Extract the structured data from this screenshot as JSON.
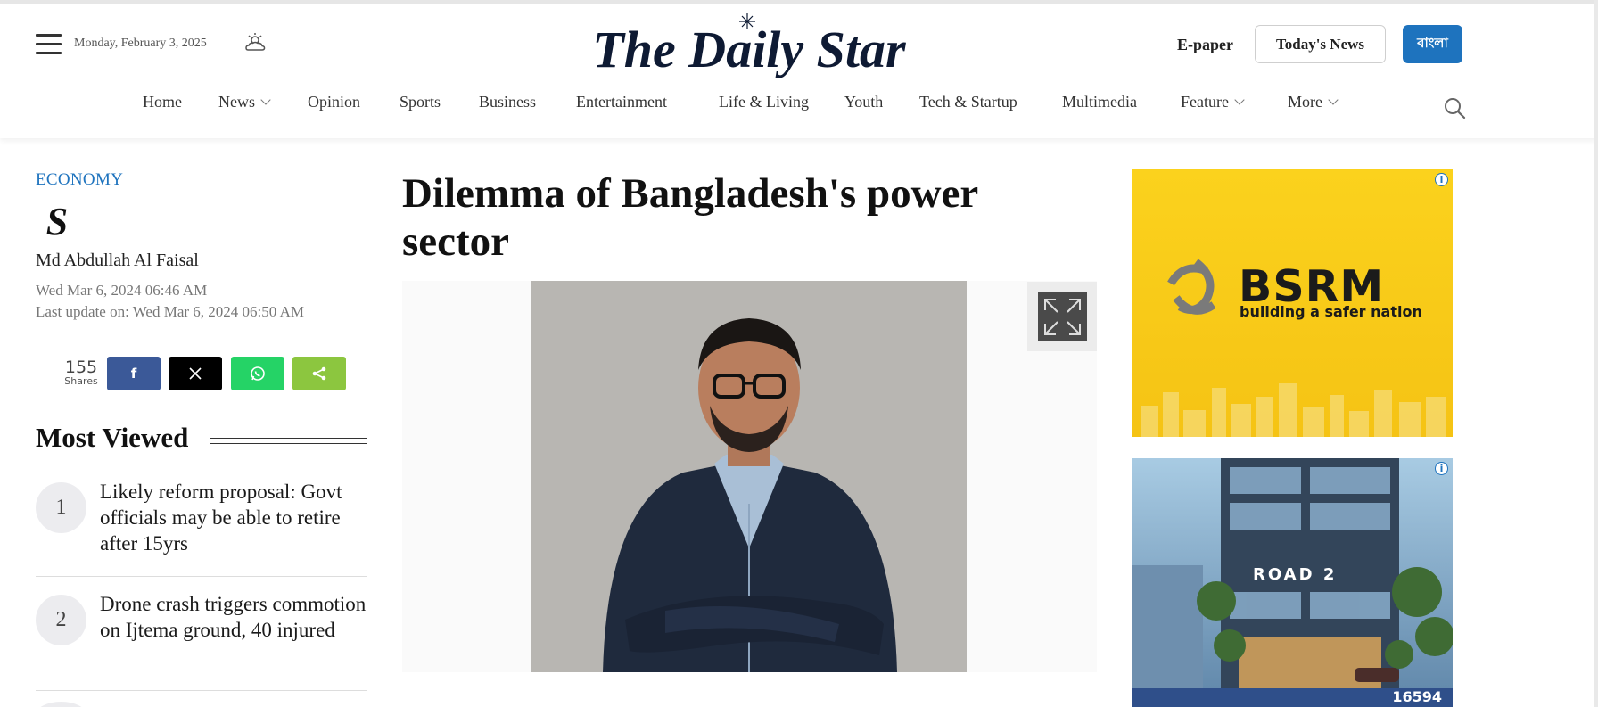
{
  "header": {
    "date": "Monday, February 3, 2025",
    "logo_text": "The Daily Star",
    "epaper_label": "E-paper",
    "todays_news_label": "Today's News",
    "bangla_label": "বাংলা"
  },
  "nav": {
    "items": [
      {
        "label": "Home",
        "dropdown": false
      },
      {
        "label": "News",
        "dropdown": true
      },
      {
        "label": "Opinion",
        "dropdown": false
      },
      {
        "label": "Sports",
        "dropdown": false
      },
      {
        "label": "Business",
        "dropdown": false
      },
      {
        "label": "Entertainment",
        "dropdown": false
      },
      {
        "label": "Life & Living",
        "dropdown": false
      },
      {
        "label": "Youth",
        "dropdown": false
      },
      {
        "label": "Tech & Startup",
        "dropdown": false
      },
      {
        "label": "Multimedia",
        "dropdown": false
      },
      {
        "label": "Feature",
        "dropdown": true
      },
      {
        "label": "More",
        "dropdown": true
      }
    ]
  },
  "article": {
    "category": "ECONOMY",
    "author": "Md Abdullah Al Faisal",
    "published": "Wed Mar 6, 2024 06:46 AM",
    "updated": "Last update on: Wed Mar 6, 2024 06:50 AM",
    "headline": "Dilemma of Bangladesh's power sector"
  },
  "share": {
    "count": "155",
    "count_label": "Shares"
  },
  "most_viewed": {
    "title": "Most Viewed",
    "items": [
      {
        "rank": "1",
        "title": "Likely reform proposal: Govt officials may be able to retire after 15yrs"
      },
      {
        "rank": "2",
        "title": "Drone crash triggers commotion on Ijtema ground, 40 injured"
      }
    ]
  },
  "ads": {
    "ad1": {
      "brand": "BSRM",
      "tagline": "building a safer nation"
    },
    "ad2": {
      "headline": "ROAD 2",
      "phone": "16594"
    }
  },
  "colors": {
    "accent_blue": "#1e73be",
    "facebook": "#3b5998",
    "x": "#000000",
    "whatsapp": "#25d366",
    "share_green": "#8cc63f",
    "ad_yellow": "#fbd21d"
  }
}
